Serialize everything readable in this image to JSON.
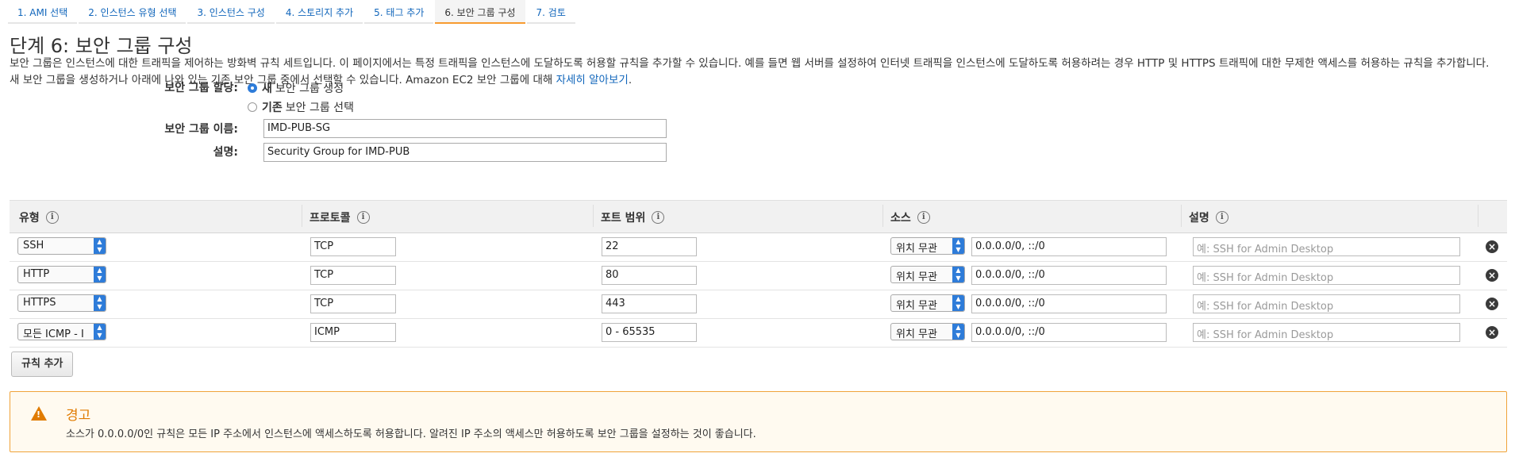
{
  "tabs": [
    {
      "label": "1. AMI 선택"
    },
    {
      "label": "2. 인스턴스 유형 선택"
    },
    {
      "label": "3. 인스턴스 구성"
    },
    {
      "label": "4. 스토리지 추가"
    },
    {
      "label": "5. 태그 추가"
    },
    {
      "label": "6. 보안 그룹 구성"
    },
    {
      "label": "7. 검토"
    }
  ],
  "page": {
    "title": "단계 6: 보안 그룹 구성",
    "intro": "보안 그룹은 인스턴스에 대한 트래픽을 제어하는 방화벽 규칙 세트입니다. 이 페이지에서는 특정 트래픽을 인스턴스에 도달하도록 허용할 규칙을 추가할 수 있습니다. 예를 들면 웹 서버를 설정하여 인터넷 트래픽을 인스턴스에 도달하도록 허용하려는 경우 HTTP 및 HTTPS 트래픽에 대한 무제한 액세스를 허용하는 규칙을 추가합니다. 새 보안 그룹을 생성하거나 아래에 나와 있는 기존 보안 그룹 중에서 선택할 수 있습니다. Amazon EC2 보안 그룹에 대해",
    "intro_link": "자세히 알아보기",
    "intro_end": "."
  },
  "form": {
    "assign_label": "보안 그룹 할당:",
    "option_new_bold": "새",
    "option_new_rest": "보안 그룹 생성",
    "option_existing_bold": "기존",
    "option_existing_rest": "보안 그룹 선택",
    "name_label": "보안 그룹 이름:",
    "name_value": "IMD-PUB-SG",
    "desc_label": "설명:",
    "desc_value": "Security Group for IMD-PUB"
  },
  "table": {
    "headers": {
      "type": "유형",
      "protocol": "프로토콜",
      "port": "포트 범위",
      "source": "소스",
      "desc": "설명"
    },
    "info_glyph": "i",
    "rows": [
      {
        "type": "SSH",
        "protocol": "TCP",
        "port": "22",
        "source_sel": "위치 무관",
        "source": "0.0.0.0/0, ::/0",
        "desc_ph": "예: SSH for Admin Desktop"
      },
      {
        "type": "HTTP",
        "protocol": "TCP",
        "port": "80",
        "source_sel": "위치 무관",
        "source": "0.0.0.0/0, ::/0",
        "desc_ph": "예: SSH for Admin Desktop"
      },
      {
        "type": "HTTPS",
        "protocol": "TCP",
        "port": "443",
        "source_sel": "위치 무관",
        "source": "0.0.0.0/0, ::/0",
        "desc_ph": "예: SSH for Admin Desktop"
      },
      {
        "type": "모든 ICMP - I",
        "protocol": "ICMP",
        "port": "0 - 65535",
        "source_sel": "위치 무관",
        "source": "0.0.0.0/0, ::/0",
        "desc_ph": "예: SSH for Admin Desktop"
      }
    ],
    "add_rule_label": "규칙 추가"
  },
  "warning": {
    "title": "경고",
    "text": "소스가 0.0.0.0/0인 규칙은 모든 IP 주소에서 인스턴스에 액세스하도록 허용합니다. 알려진 IP 주소의 액세스만 허용하도록 보안 그룹을 설정하는 것이 좋습니다."
  },
  "icons": {
    "info": "info-icon",
    "select_arrow": "select-arrows-icon",
    "remove": "remove-icon",
    "warning": "warning-icon"
  },
  "colors": {
    "link": "#1166bb",
    "accent_tab": "#f79b30",
    "warning": "#e07b00",
    "select": "#2e7cd9"
  }
}
